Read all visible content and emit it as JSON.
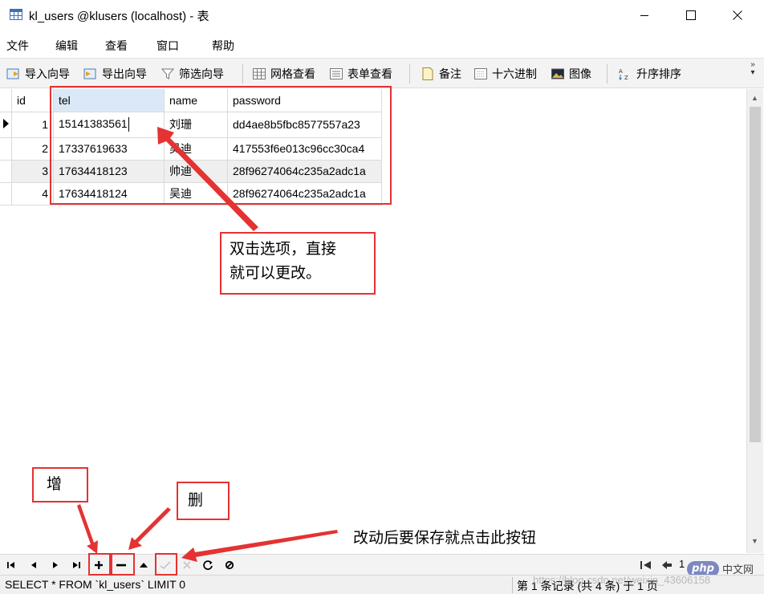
{
  "window": {
    "title": "kl_users @klusers (localhost) - 表"
  },
  "menu": [
    "文件",
    "编辑",
    "查看",
    "窗口",
    "帮助"
  ],
  "toolbar": {
    "import_wizard": "导入向导",
    "export_wizard": "导出向导",
    "filter_wizard": "筛选向导",
    "grid_view": "网格查看",
    "form_view": "表单查看",
    "memo": "备注",
    "hex": "十六进制",
    "image": "图像",
    "sort_asc": "升序排序"
  },
  "table": {
    "columns": [
      "id",
      "tel",
      "name",
      "password"
    ],
    "rows": [
      {
        "id": "1",
        "tel": "15141383561",
        "name": "刘珊",
        "password": "dd4ae8b5fbc8577557a23"
      },
      {
        "id": "2",
        "tel": "17337619633",
        "name": "吴迪",
        "password": "417553f6e013c96cc30ca4"
      },
      {
        "id": "3",
        "tel": "17634418123",
        "name": "帅迪",
        "password": "28f96274064c235a2adc1a"
      },
      {
        "id": "4",
        "tel": "17634418124",
        "name": "吴迪",
        "password": "28f96274064c235a2adc1a"
      }
    ]
  },
  "annotations": {
    "edit_note_line1": "双击选项，直接",
    "edit_note_line2": "就可以更改。",
    "add_note": "增",
    "delete_note": "删",
    "save_note": "改动后要保存就点击此按钮"
  },
  "navbar": {
    "page_number": "1",
    "watermark_php": "php",
    "watermark_site": "中文网"
  },
  "statusbar": {
    "sql": "SELECT * FROM `kl_users` LIMIT 0",
    "page_info": "第 1 条记录 (共 4 条) 于 1 页",
    "watermark_user": "https://blog.csdn.net/weixin_43606158"
  },
  "colors": {
    "annotation_red": "#e53232",
    "selected_header": "#dbe8f7",
    "alt_row": "#efefef"
  }
}
